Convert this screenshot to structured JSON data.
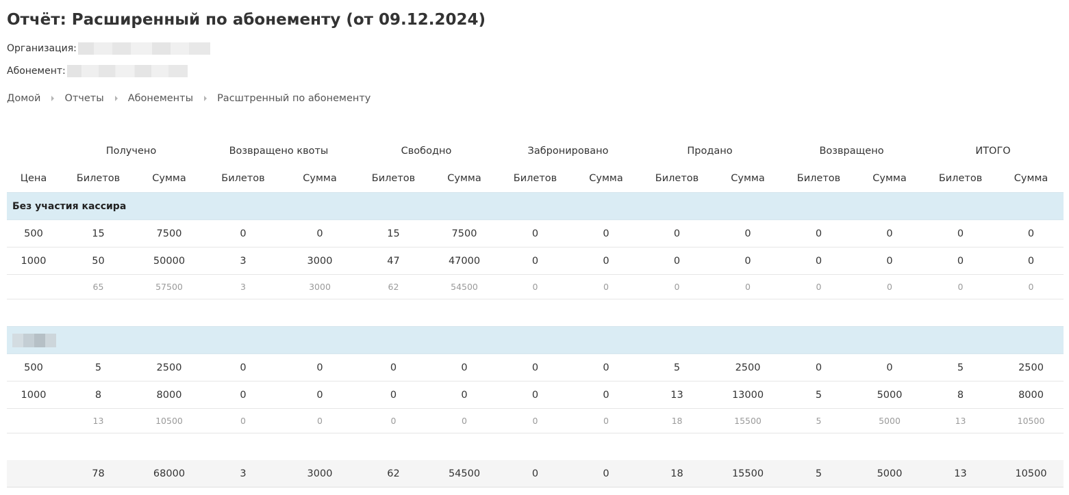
{
  "page": {
    "title": "Отчёт: Расширенный по абонементу (от 09.12.2024)",
    "org_label": "Организация:",
    "sub_label": "Абонемент:"
  },
  "breadcrumb": [
    "Домой",
    "Отчеты",
    "Абонементы",
    "Расштренный по абонементу"
  ],
  "table": {
    "group_headers": [
      "Получено",
      "Возвращено квоты",
      "Свободно",
      "Забронировано",
      "Продано",
      "Возвращено",
      "ИТОГО"
    ],
    "price_header": "Цена",
    "tickets_header": "Билетов",
    "sum_header": "Сумма",
    "sections": [
      {
        "title": "Без участия кассира",
        "rows": [
          [
            "500",
            "15",
            "7500",
            "0",
            "0",
            "15",
            "7500",
            "0",
            "0",
            "0",
            "0",
            "0",
            "0",
            "0",
            "0"
          ],
          [
            "1000",
            "50",
            "50000",
            "3",
            "3000",
            "47",
            "47000",
            "0",
            "0",
            "0",
            "0",
            "0",
            "0",
            "0",
            "0"
          ]
        ],
        "subtotal": [
          "",
          "65",
          "57500",
          "3",
          "3000",
          "62",
          "54500",
          "0",
          "0",
          "0",
          "0",
          "0",
          "0",
          "0",
          "0"
        ]
      },
      {
        "title": "",
        "rows": [
          [
            "500",
            "5",
            "2500",
            "0",
            "0",
            "0",
            "0",
            "0",
            "0",
            "5",
            "2500",
            "0",
            "0",
            "5",
            "2500"
          ],
          [
            "1000",
            "8",
            "8000",
            "0",
            "0",
            "0",
            "0",
            "0",
            "0",
            "13",
            "13000",
            "5",
            "5000",
            "8",
            "8000"
          ]
        ],
        "subtotal": [
          "",
          "13",
          "10500",
          "0",
          "0",
          "0",
          "0",
          "0",
          "0",
          "18",
          "15500",
          "5",
          "5000",
          "13",
          "10500"
        ]
      }
    ],
    "grand_total": [
      "",
      "78",
      "68000",
      "3",
      "3000",
      "62",
      "54500",
      "0",
      "0",
      "18",
      "15500",
      "5",
      "5000",
      "13",
      "10500"
    ]
  }
}
